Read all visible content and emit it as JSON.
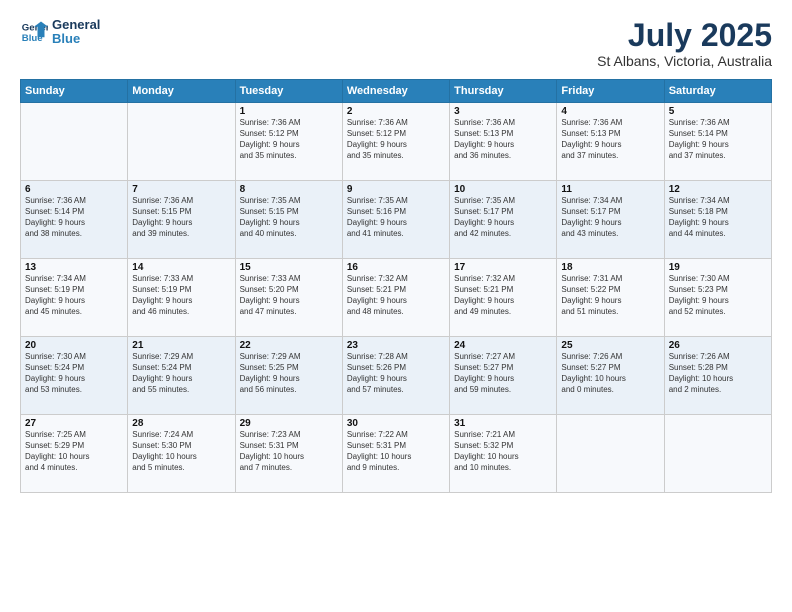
{
  "app": {
    "logo_line1": "General",
    "logo_line2": "Blue"
  },
  "title": "July 2025",
  "subtitle": "St Albans, Victoria, Australia",
  "days_of_week": [
    "Sunday",
    "Monday",
    "Tuesday",
    "Wednesday",
    "Thursday",
    "Friday",
    "Saturday"
  ],
  "weeks": [
    [
      {
        "day": "",
        "detail": ""
      },
      {
        "day": "",
        "detail": ""
      },
      {
        "day": "1",
        "detail": "Sunrise: 7:36 AM\nSunset: 5:12 PM\nDaylight: 9 hours\nand 35 minutes."
      },
      {
        "day": "2",
        "detail": "Sunrise: 7:36 AM\nSunset: 5:12 PM\nDaylight: 9 hours\nand 35 minutes."
      },
      {
        "day": "3",
        "detail": "Sunrise: 7:36 AM\nSunset: 5:13 PM\nDaylight: 9 hours\nand 36 minutes."
      },
      {
        "day": "4",
        "detail": "Sunrise: 7:36 AM\nSunset: 5:13 PM\nDaylight: 9 hours\nand 37 minutes."
      },
      {
        "day": "5",
        "detail": "Sunrise: 7:36 AM\nSunset: 5:14 PM\nDaylight: 9 hours\nand 37 minutes."
      }
    ],
    [
      {
        "day": "6",
        "detail": "Sunrise: 7:36 AM\nSunset: 5:14 PM\nDaylight: 9 hours\nand 38 minutes."
      },
      {
        "day": "7",
        "detail": "Sunrise: 7:36 AM\nSunset: 5:15 PM\nDaylight: 9 hours\nand 39 minutes."
      },
      {
        "day": "8",
        "detail": "Sunrise: 7:35 AM\nSunset: 5:15 PM\nDaylight: 9 hours\nand 40 minutes."
      },
      {
        "day": "9",
        "detail": "Sunrise: 7:35 AM\nSunset: 5:16 PM\nDaylight: 9 hours\nand 41 minutes."
      },
      {
        "day": "10",
        "detail": "Sunrise: 7:35 AM\nSunset: 5:17 PM\nDaylight: 9 hours\nand 42 minutes."
      },
      {
        "day": "11",
        "detail": "Sunrise: 7:34 AM\nSunset: 5:17 PM\nDaylight: 9 hours\nand 43 minutes."
      },
      {
        "day": "12",
        "detail": "Sunrise: 7:34 AM\nSunset: 5:18 PM\nDaylight: 9 hours\nand 44 minutes."
      }
    ],
    [
      {
        "day": "13",
        "detail": "Sunrise: 7:34 AM\nSunset: 5:19 PM\nDaylight: 9 hours\nand 45 minutes."
      },
      {
        "day": "14",
        "detail": "Sunrise: 7:33 AM\nSunset: 5:19 PM\nDaylight: 9 hours\nand 46 minutes."
      },
      {
        "day": "15",
        "detail": "Sunrise: 7:33 AM\nSunset: 5:20 PM\nDaylight: 9 hours\nand 47 minutes."
      },
      {
        "day": "16",
        "detail": "Sunrise: 7:32 AM\nSunset: 5:21 PM\nDaylight: 9 hours\nand 48 minutes."
      },
      {
        "day": "17",
        "detail": "Sunrise: 7:32 AM\nSunset: 5:21 PM\nDaylight: 9 hours\nand 49 minutes."
      },
      {
        "day": "18",
        "detail": "Sunrise: 7:31 AM\nSunset: 5:22 PM\nDaylight: 9 hours\nand 51 minutes."
      },
      {
        "day": "19",
        "detail": "Sunrise: 7:30 AM\nSunset: 5:23 PM\nDaylight: 9 hours\nand 52 minutes."
      }
    ],
    [
      {
        "day": "20",
        "detail": "Sunrise: 7:30 AM\nSunset: 5:24 PM\nDaylight: 9 hours\nand 53 minutes."
      },
      {
        "day": "21",
        "detail": "Sunrise: 7:29 AM\nSunset: 5:24 PM\nDaylight: 9 hours\nand 55 minutes."
      },
      {
        "day": "22",
        "detail": "Sunrise: 7:29 AM\nSunset: 5:25 PM\nDaylight: 9 hours\nand 56 minutes."
      },
      {
        "day": "23",
        "detail": "Sunrise: 7:28 AM\nSunset: 5:26 PM\nDaylight: 9 hours\nand 57 minutes."
      },
      {
        "day": "24",
        "detail": "Sunrise: 7:27 AM\nSunset: 5:27 PM\nDaylight: 9 hours\nand 59 minutes."
      },
      {
        "day": "25",
        "detail": "Sunrise: 7:26 AM\nSunset: 5:27 PM\nDaylight: 10 hours\nand 0 minutes."
      },
      {
        "day": "26",
        "detail": "Sunrise: 7:26 AM\nSunset: 5:28 PM\nDaylight: 10 hours\nand 2 minutes."
      }
    ],
    [
      {
        "day": "27",
        "detail": "Sunrise: 7:25 AM\nSunset: 5:29 PM\nDaylight: 10 hours\nand 4 minutes."
      },
      {
        "day": "28",
        "detail": "Sunrise: 7:24 AM\nSunset: 5:30 PM\nDaylight: 10 hours\nand 5 minutes."
      },
      {
        "day": "29",
        "detail": "Sunrise: 7:23 AM\nSunset: 5:31 PM\nDaylight: 10 hours\nand 7 minutes."
      },
      {
        "day": "30",
        "detail": "Sunrise: 7:22 AM\nSunset: 5:31 PM\nDaylight: 10 hours\nand 9 minutes."
      },
      {
        "day": "31",
        "detail": "Sunrise: 7:21 AM\nSunset: 5:32 PM\nDaylight: 10 hours\nand 10 minutes."
      },
      {
        "day": "",
        "detail": ""
      },
      {
        "day": "",
        "detail": ""
      }
    ]
  ]
}
